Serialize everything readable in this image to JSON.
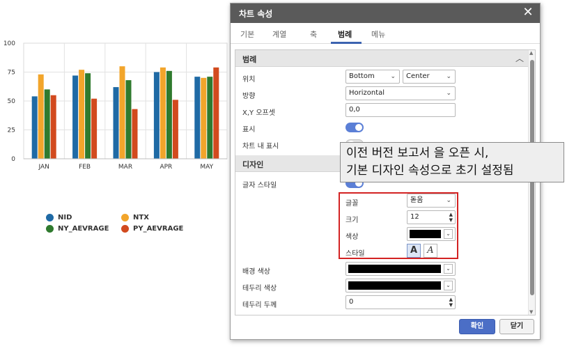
{
  "chart_data": {
    "type": "bar",
    "categories": [
      "JAN",
      "FEB",
      "MAR",
      "APR",
      "MAY"
    ],
    "yticks": [
      "0",
      "25",
      "50",
      "75",
      "100"
    ],
    "ylim": [
      0,
      100
    ],
    "grid": true,
    "legend_placement": "bottom",
    "series": [
      {
        "name": "NID",
        "color": "#1f6aa5",
        "values": [
          54,
          72,
          62,
          75,
          71
        ]
      },
      {
        "name": "NTX",
        "color": "#f2a52b",
        "values": [
          73,
          77,
          80,
          79,
          70
        ]
      },
      {
        "name": "NY_AEVRAGE",
        "color": "#2f7a2e",
        "values": [
          60,
          74,
          68,
          76,
          71
        ]
      },
      {
        "name": "PY_AEVRAGE",
        "color": "#d24a1e",
        "values": [
          55,
          52,
          43,
          51,
          79
        ]
      }
    ]
  },
  "dialog": {
    "title": "차트 속성",
    "close_glyph": "✕",
    "tabs": [
      "기본",
      "계열",
      "축",
      "범례",
      "메뉴"
    ],
    "active_tab": "범례",
    "legend_section": {
      "title": "범례",
      "collapse_glyph": "︿",
      "position_label": "위치",
      "position_vertical": "Bottom",
      "position_horizontal": "Center",
      "direction_label": "방향",
      "direction_value": "Horizontal",
      "offset_label": "X,Y 오프셋",
      "offset_value": "0,0",
      "show_label": "표시",
      "show_value": true,
      "inside_label": "차트 내 표시",
      "inside_value": false
    },
    "design_section": {
      "title": "디자인",
      "font_style_label": "글자 스타일",
      "font_label": "글꼴",
      "font_value": "돋움",
      "size_label": "크기",
      "size_value": "12",
      "color_label": "색상",
      "color_value": "#000000",
      "style_label": "스타일",
      "style_bold_glyph": "A",
      "style_italic_glyph": "A",
      "bg_color_label": "배경 색상",
      "bg_color_value": "#000000",
      "border_color_label": "테두리 색상",
      "border_color_value": "#000000",
      "border_width_label": "테두리 두께",
      "border_width_value": "0"
    },
    "ok_label": "확인",
    "close_label": "닫기"
  },
  "callout": {
    "line1": "이전 버전 보고서 을 오픈 시,",
    "line2": "기본 디자인 속성으로 초기 설정됨"
  }
}
